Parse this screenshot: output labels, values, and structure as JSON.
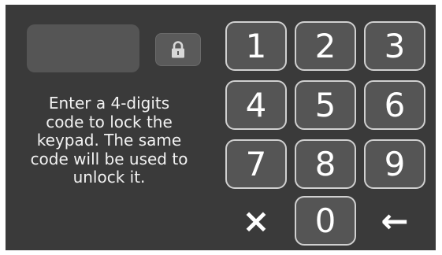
{
  "lock_button": {
    "icon": "lock-icon"
  },
  "message": "Enter a 4-digits\ncode to lock the\nkeypad. The same\ncode will be used to\nunlock it.",
  "keypad": {
    "keys": [
      "1",
      "2",
      "3",
      "4",
      "5",
      "6",
      "7",
      "8",
      "9"
    ],
    "clear": {
      "label": "×",
      "icon": "clear-icon"
    },
    "zero": "0",
    "backspace": {
      "label": "←",
      "icon": "backspace-arrow-icon"
    }
  },
  "colors": {
    "background": "#3a3a3a",
    "key_fill": "#555555",
    "key_border": "#d0d0d0",
    "text": "#ffffff"
  }
}
